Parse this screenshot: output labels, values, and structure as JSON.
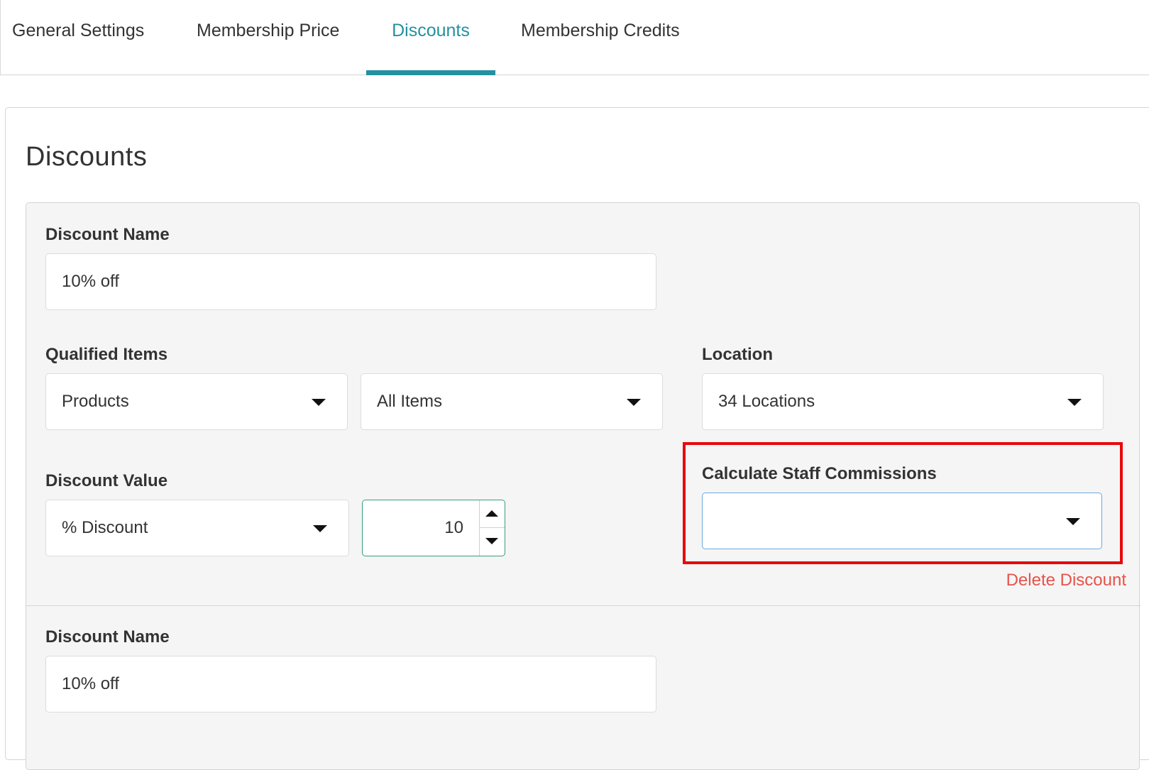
{
  "tabs": [
    {
      "label": "General Settings",
      "active": false
    },
    {
      "label": "Membership Price",
      "active": false
    },
    {
      "label": "Discounts",
      "active": true
    },
    {
      "label": "Membership Credits",
      "active": false
    }
  ],
  "section": {
    "title": "Discounts"
  },
  "discount_1": {
    "name_label": "Discount Name",
    "name_value": "10% off",
    "qualified_items_label": "Qualified Items",
    "qualified_type": "Products",
    "qualified_scope": "All Items",
    "location_label": "Location",
    "location_value": "34 Locations",
    "value_label": "Discount Value",
    "value_type": "% Discount",
    "value_amount": "10",
    "commission_label": "Calculate Staff Commissions",
    "commission_value": "",
    "delete_label": "Delete Discount"
  },
  "discount_2": {
    "name_label": "Discount Name",
    "name_value": "10% off"
  },
  "colors": {
    "accent": "#2391a0",
    "highlight": "#e8090c",
    "delete": "#e8524a",
    "number_border": "#34a07a"
  },
  "icons": [
    "caret-down-icon",
    "stepper-up-icon",
    "stepper-down-icon"
  ]
}
